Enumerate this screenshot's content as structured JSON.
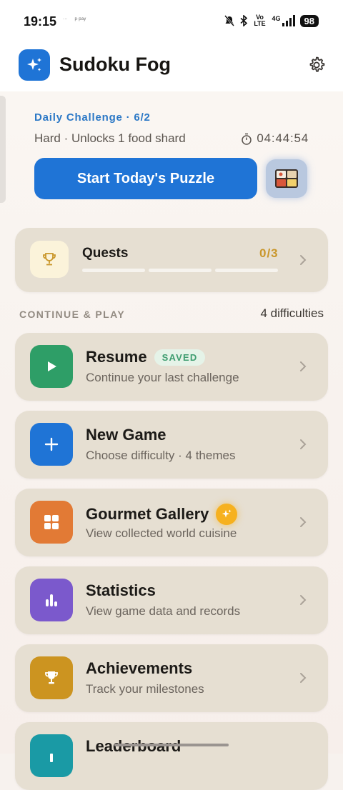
{
  "status": {
    "time": "19:15",
    "mini_notifs": [
      "···",
      "p·pay"
    ],
    "net": "Vo LTE",
    "net4g": "4G",
    "battery": "98"
  },
  "app": {
    "title": "Sudoku Fog",
    "accent": "#1f74d6"
  },
  "daily": {
    "label": "Daily Challenge · 6/2",
    "subtitle": "Hard · Unlocks 1 food shard",
    "timer": "04:44:54",
    "start_label": "Start Today's Puzzle"
  },
  "quests": {
    "title": "Quests",
    "count": "0/3",
    "progress": 0
  },
  "section": {
    "left": "CONTINUE & PLAY",
    "right": "4 difficulties"
  },
  "menu": [
    {
      "title": "Resume",
      "subtitle": "Continue your last challenge",
      "badge": "SAVED",
      "color": "#2e9e67",
      "icon": "play-icon"
    },
    {
      "title": "New Game",
      "subtitle": "Choose difficulty · 4 themes",
      "color": "#1f74d6",
      "icon": "plus-icon"
    },
    {
      "title": "Gourmet Gallery",
      "subtitle": "View collected world cuisine",
      "color": "#e27a35",
      "icon": "grid-icon"
    },
    {
      "title": "Statistics",
      "subtitle": "View game data and records",
      "color": "#7b59cc",
      "icon": "bar-chart-icon"
    },
    {
      "title": "Achievements",
      "subtitle": "Track your milestones",
      "color": "#cc9420",
      "icon": "trophy-icon"
    },
    {
      "title": "Leaderboard",
      "subtitle": "",
      "color": "#1a9aa5",
      "icon": "leaderboard-icon"
    }
  ]
}
